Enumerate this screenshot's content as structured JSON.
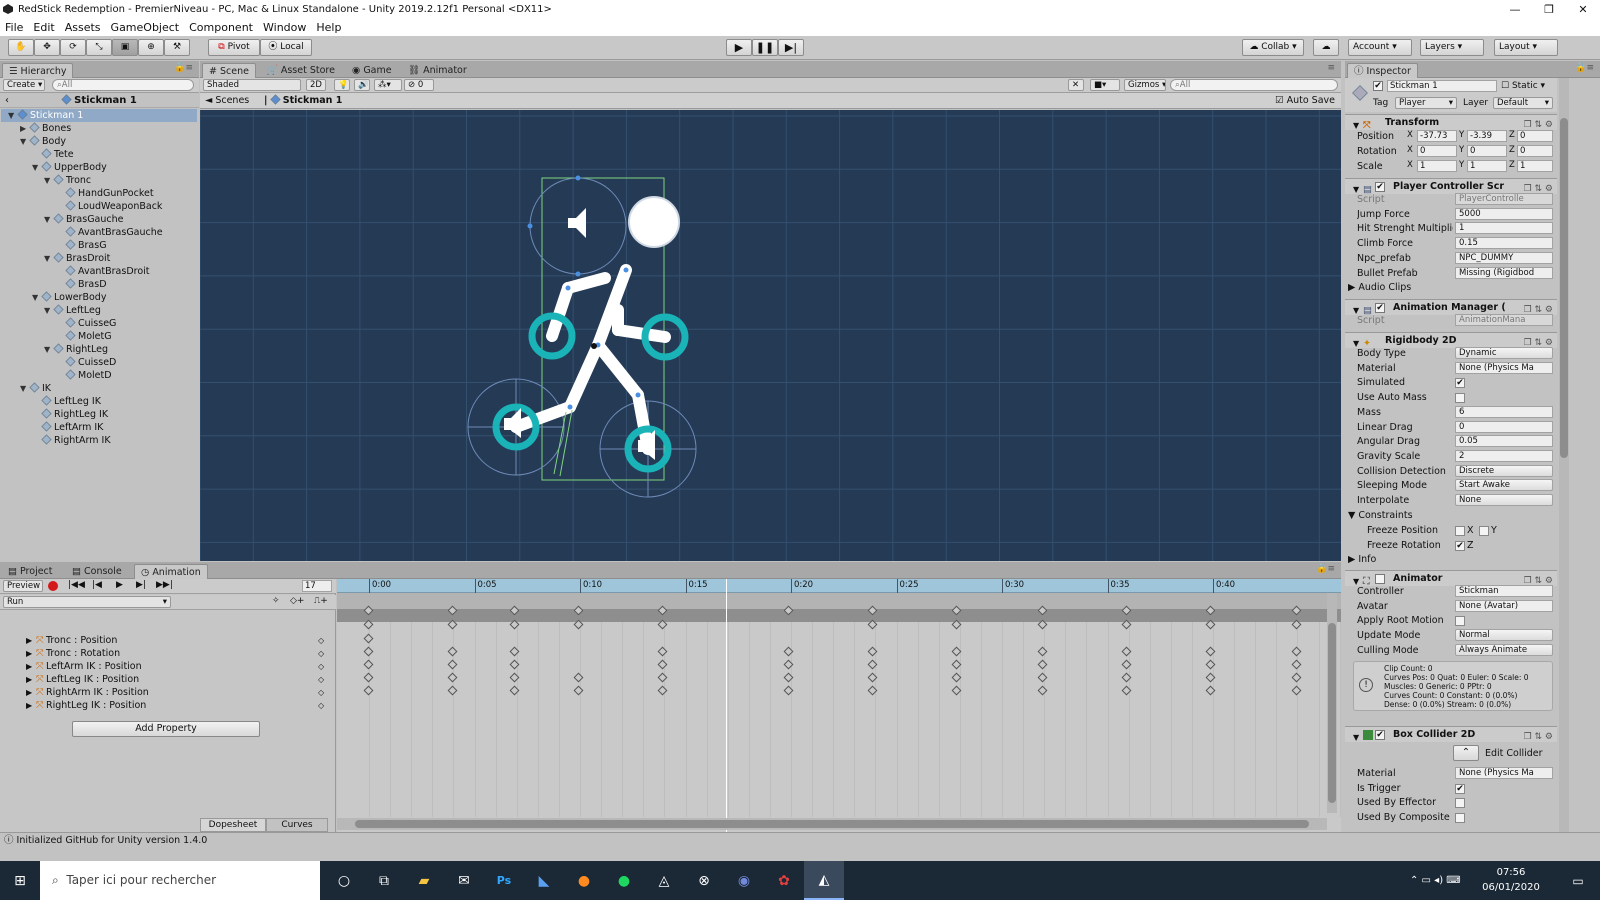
{
  "window": {
    "title": "RedStick Redemption - PremierNiveau - PC, Mac & Linux Standalone - Unity 2019.2.12f1 Personal <DX11>",
    "controls": [
      "—",
      "❐",
      "✕"
    ]
  },
  "menu": [
    "File",
    "Edit",
    "Assets",
    "GameObject",
    "Component",
    "Window",
    "Help"
  ],
  "toolbar": {
    "pivot": "Pivot",
    "local": "Local",
    "collab": "Collab",
    "account": "Account",
    "layers": "Layers",
    "layout": "Layout"
  },
  "hierarchy": {
    "tab": "Hierarchy",
    "create": "Create",
    "search_placeholder": "All",
    "scene_name": "Stickman 1",
    "items": [
      {
        "label": "Stickman 1",
        "depth": 0,
        "arrow": "▼",
        "selected": true
      },
      {
        "label": "Bones",
        "depth": 1,
        "arrow": "▶"
      },
      {
        "label": "Body",
        "depth": 1,
        "arrow": "▼"
      },
      {
        "label": "Tete",
        "depth": 2,
        "arrow": ""
      },
      {
        "label": "UpperBody",
        "depth": 2,
        "arrow": "▼"
      },
      {
        "label": "Tronc",
        "depth": 3,
        "arrow": "▼"
      },
      {
        "label": "HandGunPocket",
        "depth": 4,
        "arrow": ""
      },
      {
        "label": "LoudWeaponBack",
        "depth": 4,
        "arrow": ""
      },
      {
        "label": "BrasGauche",
        "depth": 3,
        "arrow": "▼"
      },
      {
        "label": "AvantBrasGauche",
        "depth": 4,
        "arrow": ""
      },
      {
        "label": "BrasG",
        "depth": 4,
        "arrow": ""
      },
      {
        "label": "BrasDroit",
        "depth": 3,
        "arrow": "▼"
      },
      {
        "label": "AvantBrasDroit",
        "depth": 4,
        "arrow": ""
      },
      {
        "label": "BrasD",
        "depth": 4,
        "arrow": ""
      },
      {
        "label": "LowerBody",
        "depth": 2,
        "arrow": "▼"
      },
      {
        "label": "LeftLeg",
        "depth": 3,
        "arrow": "▼"
      },
      {
        "label": "CuisseG",
        "depth": 4,
        "arrow": ""
      },
      {
        "label": "MoletG",
        "depth": 4,
        "arrow": ""
      },
      {
        "label": "RightLeg",
        "depth": 3,
        "arrow": "▼"
      },
      {
        "label": "CuisseD",
        "depth": 4,
        "arrow": ""
      },
      {
        "label": "MoletD",
        "depth": 4,
        "arrow": ""
      },
      {
        "label": "IK",
        "depth": 1,
        "arrow": "▼"
      },
      {
        "label": "LeftLeg IK",
        "depth": 2,
        "arrow": ""
      },
      {
        "label": "RightLeg IK",
        "depth": 2,
        "arrow": ""
      },
      {
        "label": "LeftArm IK",
        "depth": 2,
        "arrow": ""
      },
      {
        "label": "RightArm IK",
        "depth": 2,
        "arrow": ""
      }
    ]
  },
  "scene": {
    "tabs": [
      "Scene",
      "Asset Store",
      "Game",
      "Animator"
    ],
    "shading": "Shaded",
    "mode_2d": "2D",
    "hidden_count": "0",
    "gizmos": "Gizmos",
    "search_placeholder": "All",
    "breadcrumb_root": "Scenes",
    "breadcrumb_current": "Stickman 1",
    "auto_save": "Auto Save",
    "background": "#243a55"
  },
  "animation": {
    "tabs": [
      "Project",
      "Console",
      "Animation"
    ],
    "preview": "Preview",
    "frame": "17",
    "clip": "Run",
    "tracks": [
      "Tronc : Position",
      "Tronc : Rotation",
      "LeftArm IK : Position",
      "LeftLeg IK : Position",
      "RightArm IK : Position",
      "RightLeg IK : Position"
    ],
    "add_property": "Add Property",
    "time_labels": [
      "0:00",
      "0:05",
      "0:10",
      "0:15",
      "0:20",
      "0:25",
      "0:30",
      "0:35",
      "0:40"
    ],
    "bottom_tabs": [
      "Dopesheet",
      "Curves"
    ]
  },
  "inspector": {
    "tab": "Inspector",
    "object_name": "Stickman 1",
    "static_label": "Static",
    "tag_label": "Tag",
    "tag_value": "Player",
    "layer_label": "Layer",
    "layer_value": "Default",
    "transform": {
      "title": "Transform",
      "position_label": "Position",
      "rotation_label": "Rotation",
      "scale_label": "Scale",
      "position": [
        "-37.73",
        "-3.39",
        "0"
      ],
      "rotation": [
        "0",
        "0",
        "0"
      ],
      "scale": [
        "1",
        "1",
        "1"
      ]
    },
    "player_controller": {
      "title": "Player Controller Scr",
      "rows": [
        {
          "label": "Script",
          "value": "PlayerControlle"
        },
        {
          "label": "Jump Force",
          "value": "5000"
        },
        {
          "label": "Hit Strenght Multiplie",
          "value": "1"
        },
        {
          "label": "Climb Force",
          "value": "0.15"
        },
        {
          "label": "Npc_prefab",
          "value": "NPC_DUMMY"
        },
        {
          "label": "Bullet Prefab",
          "value": "Missing (Rigidbod"
        }
      ],
      "audio_clips": "Audio Clips"
    },
    "animation_manager": {
      "title": "Animation Manager (",
      "script_label": "Script",
      "script_value": "AnimationMana"
    },
    "rigidbody": {
      "title": "Rigidbody 2D",
      "rows": [
        {
          "label": "Body Type",
          "value": "Dynamic",
          "kind": "drop"
        },
        {
          "label": "Material",
          "value": "None (Physics Ma",
          "kind": "field"
        },
        {
          "label": "Simulated",
          "value": "✔",
          "kind": "check"
        },
        {
          "label": "Use Auto Mass",
          "value": "",
          "kind": "check"
        },
        {
          "label": "Mass",
          "value": "6",
          "kind": "field"
        },
        {
          "label": "Linear Drag",
          "value": "0",
          "kind": "field"
        },
        {
          "label": "Angular Drag",
          "value": "0.05",
          "kind": "field"
        },
        {
          "label": "Gravity Scale",
          "value": "2",
          "kind": "field"
        },
        {
          "label": "Collision Detection",
          "value": "Discrete",
          "kind": "drop"
        },
        {
          "label": "Sleeping Mode",
          "value": "Start Awake",
          "kind": "drop"
        },
        {
          "label": "Interpolate",
          "value": "None",
          "kind": "drop"
        }
      ],
      "constraints": "Constraints",
      "freeze_position": "Freeze Position",
      "freeze_rotation": "Freeze Rotation",
      "info": "Info"
    },
    "animator": {
      "title": "Animator",
      "rows": [
        {
          "label": "Controller",
          "value": "Stickman",
          "kind": "field"
        },
        {
          "label": "Avatar",
          "value": "None (Avatar)",
          "kind": "field"
        },
        {
          "label": "Apply Root Motion",
          "value": "",
          "kind": "check"
        },
        {
          "label": "Update Mode",
          "value": "Normal",
          "kind": "drop"
        },
        {
          "label": "Culling Mode",
          "value": "Always Animate",
          "kind": "drop"
        }
      ],
      "info": [
        "Clip Count: 0",
        "Curves Pos: 0 Quat: 0 Euler: 0 Scale: 0",
        "Muscles: 0 Generic: 0 PPtr: 0",
        "Curves Count: 0 Constant: 0 (0.0%)",
        "Dense: 0 (0.0%) Stream: 0 (0.0%)"
      ]
    },
    "box_collider": {
      "title": "Box Collider 2D",
      "edit_collider": "Edit Collider",
      "rows": [
        {
          "label": "Material",
          "value": "None (Physics Ma",
          "kind": "field"
        },
        {
          "label": "Is Trigger",
          "value": "✔",
          "kind": "check"
        },
        {
          "label": "Used By Effector",
          "value": "",
          "kind": "check"
        },
        {
          "label": "Used By Composite",
          "value": "",
          "kind": "check"
        }
      ]
    }
  },
  "status": "Initialized GitHub for Unity version 1.4.0",
  "taskbar": {
    "search_placeholder": "Taper ici pour rechercher",
    "time": "07:56",
    "date": "06/01/2020"
  }
}
